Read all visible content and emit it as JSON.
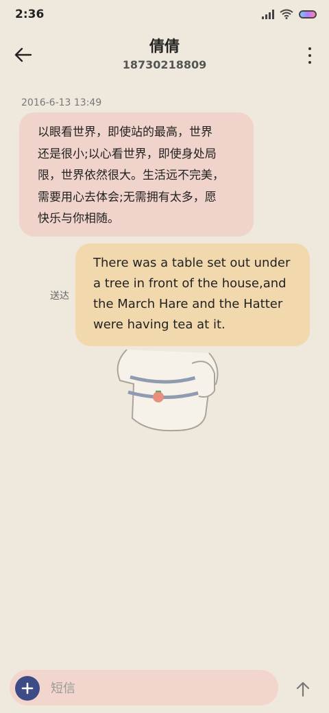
{
  "status_bar": {
    "time": "2:36",
    "icons": [
      "signal-icon",
      "wifi-icon",
      "battery-icon"
    ]
  },
  "header": {
    "back_icon": "arrow-left-icon",
    "contact_name": "倩倩",
    "contact_number": "18730218809",
    "more_icon": "more-vertical-icon"
  },
  "messages": [
    {
      "direction": "incoming",
      "timestamp": "2016-6-13 13:49",
      "lines": [
        "以眼看世界，即使站的最高，世界",
        "还是很小;以心看世界，即使身处局",
        "限，世界依然很大。生活远不完美，",
        "需要用心去体会;无需拥有太多，愿",
        "快乐与你相随。"
      ]
    },
    {
      "direction": "outgoing",
      "status": "送达",
      "lines": [
        "There was a table set out under",
        "a tree in front of the house,and",
        "the March Hare and the Hatter",
        "were having tea at it."
      ]
    }
  ],
  "composer": {
    "add_icon": "plus-icon",
    "placeholder": "短信",
    "send_icon": "arrow-up-icon"
  },
  "colors": {
    "background": "#efe8dd",
    "incoming_bubble": "#f0d3cb",
    "outgoing_bubble": "#f2d9ad",
    "accent": "#3d4b86"
  }
}
